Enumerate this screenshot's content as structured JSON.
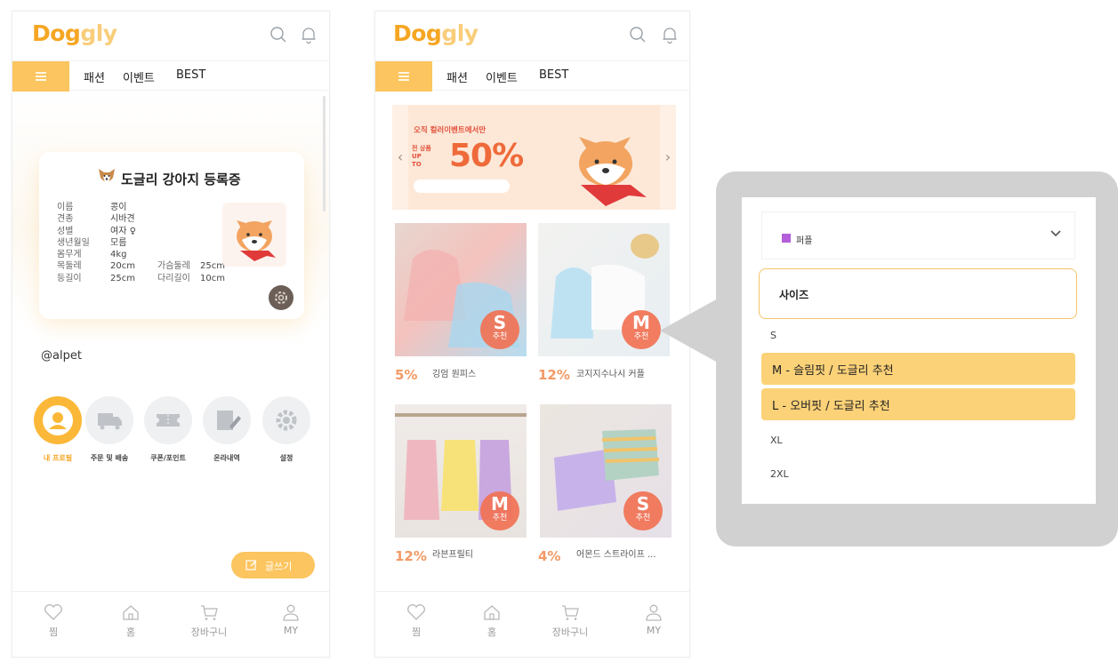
{
  "app": {
    "logo_main": "Dog",
    "logo_sub": "gly"
  },
  "nav": {
    "items": [
      "패션",
      "이벤트",
      "BEST"
    ]
  },
  "screen1": {
    "card": {
      "title": "도글리 강아지 등록증",
      "rows": [
        {
          "k": "이름",
          "v": "콩이",
          "k2": "",
          "v2": ""
        },
        {
          "k": "견종",
          "v": "시바견",
          "k2": "",
          "v2": ""
        },
        {
          "k": "성별",
          "v": "여자 ♀",
          "k2": "",
          "v2": ""
        },
        {
          "k": "생년월일",
          "v": "모름",
          "k2": "",
          "v2": ""
        },
        {
          "k": "몸무게",
          "v": "4kg",
          "k2": "",
          "v2": ""
        },
        {
          "k": "목둘레",
          "v": "20cm",
          "k2": "가슴둘레",
          "v2": "25cm"
        },
        {
          "k": "등길이",
          "v": "25cm",
          "k2": "다리길이",
          "v2": "10cm"
        }
      ]
    },
    "handle": "@alpet",
    "menu": [
      {
        "label": "내 프로필",
        "icon": "profile-icon"
      },
      {
        "label": "주문 및 배송",
        "icon": "truck-icon"
      },
      {
        "label": "쿠폰/포인트",
        "icon": "coupon-icon"
      },
      {
        "label": "온라내역",
        "icon": "edit-note-icon"
      },
      {
        "label": "설정",
        "icon": "gear-icon"
      }
    ],
    "write_button": "글쓰기"
  },
  "screen2": {
    "banner": {
      "small": "오직 컬러이벤트에서만",
      "upto": "전 상품 UP TO",
      "percent": "50%"
    },
    "products": [
      {
        "discount": "5%",
        "name": "깅엄 원피스",
        "badge_size": "S",
        "badge_text": "추천"
      },
      {
        "discount": "12%",
        "name": "코지지수나시 커플",
        "badge_size": "M",
        "badge_text": "추천"
      },
      {
        "discount": "12%",
        "name": "라븐프릴티",
        "badge_size": "M",
        "badge_text": "추천"
      },
      {
        "discount": "4%",
        "name": "어몬드 스트라이프 ...",
        "badge_size": "S",
        "badge_text": "추천"
      }
    ]
  },
  "tabbar": [
    {
      "label": "찜",
      "icon": "heart-icon"
    },
    {
      "label": "홈",
      "icon": "home-icon"
    },
    {
      "label": "장바구니",
      "icon": "cart-icon"
    },
    {
      "label": "MY",
      "icon": "person-icon"
    }
  ],
  "option_panel": {
    "color_value": "퍼플",
    "color_swatch": "#b45ed9",
    "size_label": "사이즈",
    "options": [
      "S",
      "M - 슬림핏 / 도글리 추천",
      "L - 오버핏 / 도글리 추천",
      "XL",
      "2XL"
    ]
  },
  "colors": {
    "accent": "#fcc55f",
    "brand": "#f5a623",
    "badge": "#f17254"
  }
}
